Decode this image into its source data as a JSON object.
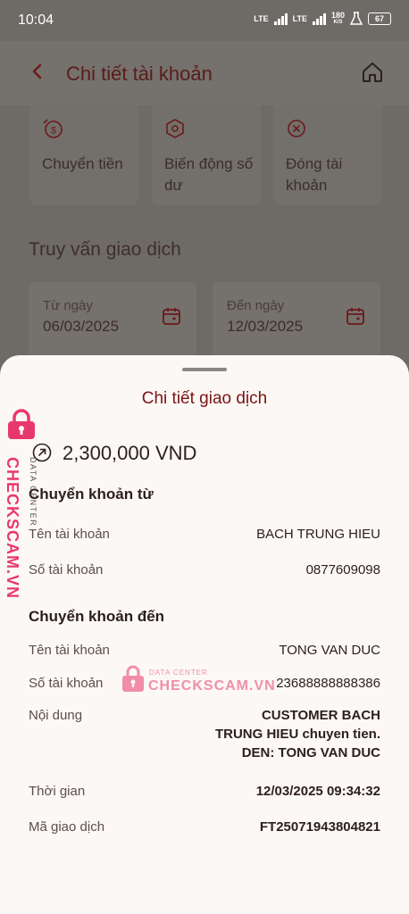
{
  "status_bar": {
    "time": "10:04",
    "net1": "LTE",
    "net2": "LTE",
    "speed": "180",
    "speed_unit": "K/S",
    "battery": "67"
  },
  "header": {
    "title": "Chi tiết tài khoản",
    "back_icon": "chevron-left-icon",
    "home_icon": "home-icon"
  },
  "actions": [
    {
      "label": "Chuyển tiền",
      "icon": "dollar-transfer-icon"
    },
    {
      "label": "Biến động số dư",
      "icon": "hexagon-icon"
    },
    {
      "label": "Đóng tài khoản",
      "icon": "close-circle-icon"
    }
  ],
  "query": {
    "title": "Truy vấn giao dịch",
    "from_label": "Từ ngày",
    "from_value": "06/03/2025",
    "to_label": "Đến ngày",
    "to_value": "12/03/2025"
  },
  "sheet": {
    "title": "Chi tiết giao dịch",
    "amount": "2,300,000 VND",
    "from_section": "Chuyển khoản từ",
    "from_name_label": "Tên tài khoản",
    "from_name_value": "BACH TRUNG HIEU",
    "from_acc_label": "Số tài khoản",
    "from_acc_value": "0877609098",
    "to_section": "Chuyển khoản đến",
    "to_name_label": "Tên tài khoản",
    "to_name_value": "TONG VAN DUC",
    "to_acc_label": "Số tài khoản",
    "to_acc_value": "23688888888386",
    "content_label": "Nội dung",
    "content_value": "CUSTOMER BACH\nTRUNG HIEU chuyen tien.\nDEN: TONG VAN DUC",
    "time_label": "Thời gian",
    "time_value": "12/03/2025 09:34:32",
    "txid_label": "Mã giao dịch",
    "txid_value": "FT25071943804821"
  },
  "watermark": {
    "main": "CHECKSCAM.VN",
    "sub": "DATA CENTER",
    "color": "#e8386b"
  }
}
